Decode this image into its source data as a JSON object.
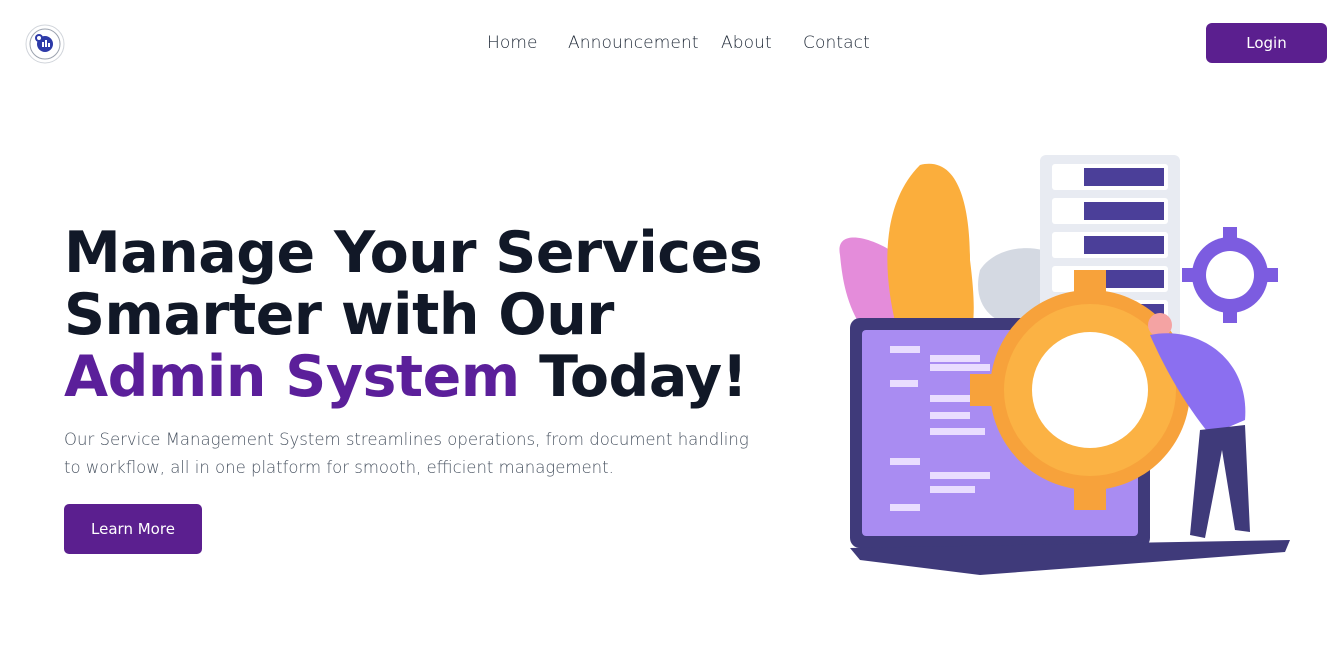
{
  "nav": {
    "links": [
      "Home",
      "Announcement",
      "About",
      "Contact"
    ],
    "login_label": "Login"
  },
  "hero": {
    "title_part1": "Manage Your Services Smarter with Our ",
    "title_accent": "Admin System",
    "title_part2": " Today!",
    "description": "Our Service Management System streamlines operations, from document handling to workflow, all in one platform for smooth, efficient management.",
    "cta_label": "Learn More"
  },
  "colors": {
    "brand": "#5b1f8f",
    "accent_text": "#5b1f9a",
    "gear_orange": "#f59e3b",
    "laptop_purple": "#4b3f99"
  },
  "icons": {
    "logo": "organization-seal-logo",
    "illustration": "server-gear-laptop-illustration"
  }
}
